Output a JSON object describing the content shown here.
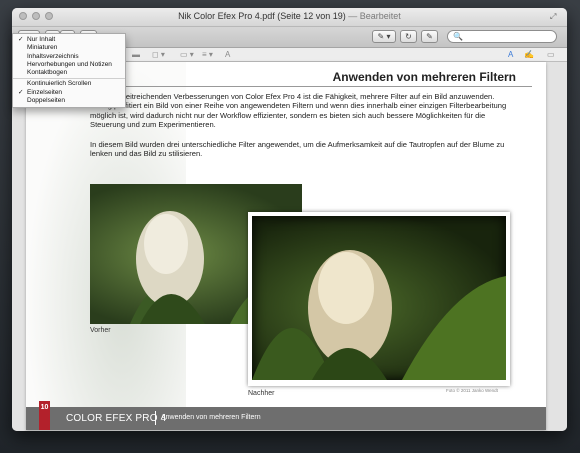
{
  "window": {
    "title": "Nik Color Efex Pro 4.pdf (Seite 12 von 19)",
    "edited": "— Bearbeitet"
  },
  "toolbar": {
    "sidebar_btn": "▣ ▾",
    "zoom_out": "−",
    "zoom_in": "+",
    "share": "⇪",
    "annotate": "✎ ▾",
    "rotate": "↻",
    "edit": "✎",
    "search_placeholder": "🔍"
  },
  "view_menu": {
    "items": [
      {
        "label": "Nur Inhalt",
        "checked": "✓"
      },
      {
        "label": "Miniaturen",
        "checked": ""
      },
      {
        "label": "Inhaltsverzeichnis",
        "checked": ""
      },
      {
        "label": "Hervorhebungen und Notizen",
        "checked": ""
      },
      {
        "label": "Kontaktbogen",
        "checked": ""
      }
    ],
    "items2": [
      {
        "label": "Kontinuierlich Scrollen",
        "checked": ""
      },
      {
        "label": "Einzelseiten",
        "checked": "✓"
      },
      {
        "label": "Doppelseiten",
        "checked": ""
      }
    ]
  },
  "page": {
    "heading": "Anwenden von mehreren Filtern",
    "para1": "Eine der weitreichenden Verbesserungen von Color Efex Pro 4 ist die Fähigkeit, mehrere Filter auf ein Bild anzuwenden. Häufig profitiert ein Bild von einer Reihe von angewendeten Filtern und wenn dies innerhalb einer einzigen Filterbearbeitung möglich ist, wird dadurch nicht nur der Workflow effizienter, sondern es bieten sich auch bessere Möglichkeiten für die Steuerung und zum Experimentieren.",
    "para2": "In diesem Bild wurden drei unterschiedliche Filter angewendet, um die Aufmerksamkeit auf die Tautropfen auf der Blume zu lenken und das Bild zu stilisieren.",
    "caption_before": "Vorher",
    "caption_after": "Nachher",
    "photo_credit": "Foto © 2011 Janko Wendt",
    "page_number": "10",
    "footer_brand": "COLOR EFEX PRO 4",
    "footer_section": "Anwenden von mehreren Filtern"
  }
}
